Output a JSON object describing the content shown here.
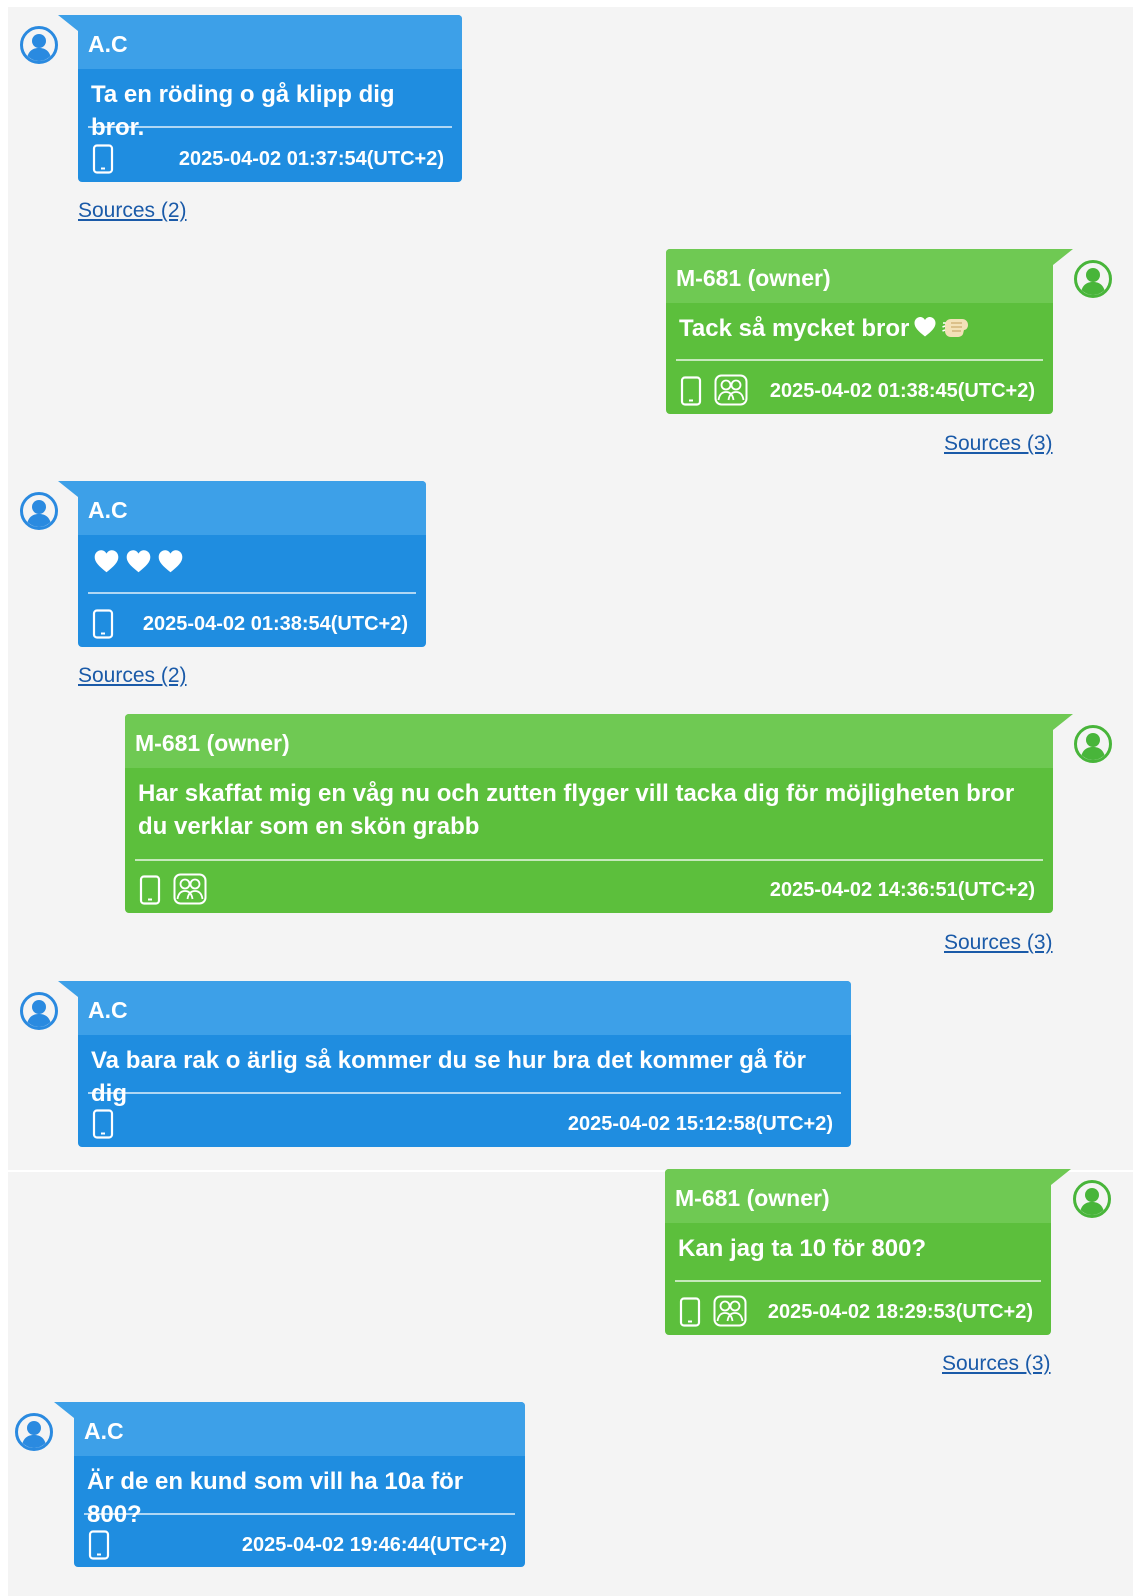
{
  "conversation": {
    "messages": [
      {
        "sender": "A.C",
        "text": "Ta en röding o gå klipp dig bror.",
        "timestamp": "2025-04-02 01:37:54(UTC+2)",
        "sources": "Sources (2)"
      },
      {
        "sender": "M-681 (owner)",
        "text": "Tack så mycket bror",
        "text_emojis": [
          "white-heart",
          "fist-bump"
        ],
        "timestamp": "2025-04-02 01:38:45(UTC+2)",
        "sources": "Sources (3)"
      },
      {
        "sender": "A.C",
        "text": "",
        "text_emojis": [
          "white-heart",
          "white-heart",
          "white-heart"
        ],
        "timestamp": "2025-04-02 01:38:54(UTC+2)",
        "sources": "Sources (2)"
      },
      {
        "sender": "M-681 (owner)",
        "text": "Har skaffat mig en våg nu och zutten flyger vill tacka dig för möjligheten bror du verklar som en skön grabb",
        "timestamp": "2025-04-02 14:36:51(UTC+2)",
        "sources": "Sources (3)"
      },
      {
        "sender": "A.C",
        "text": "Va bara rak o ärlig så kommer du se hur bra det kommer gå för dig",
        "timestamp": "2025-04-02 15:12:58(UTC+2)",
        "sources": ""
      },
      {
        "sender": "M-681 (owner)",
        "text": "Kan jag ta 10 för 800?",
        "timestamp": "2025-04-02 18:29:53(UTC+2)",
        "sources": "Sources (3)"
      },
      {
        "sender": "A.C",
        "text": "Är de en kund som vill ha 10a för 800?",
        "timestamp": "2025-04-02 19:46:44(UTC+2)",
        "sources": ""
      }
    ]
  },
  "colors": {
    "incoming_body": "#1f8de0",
    "incoming_header": "#3da0e8",
    "outgoing_body": "#5cbf3c",
    "outgoing_header": "#6fc953",
    "avatar_incoming": "#2a8ae0",
    "avatar_outgoing": "#48b53a",
    "link": "#1a5aa8",
    "background": "#f4f4f4"
  },
  "icons": [
    "user-avatar-icon",
    "phone-icon",
    "group-icon",
    "heart-emoji",
    "fist-bump-emoji"
  ]
}
